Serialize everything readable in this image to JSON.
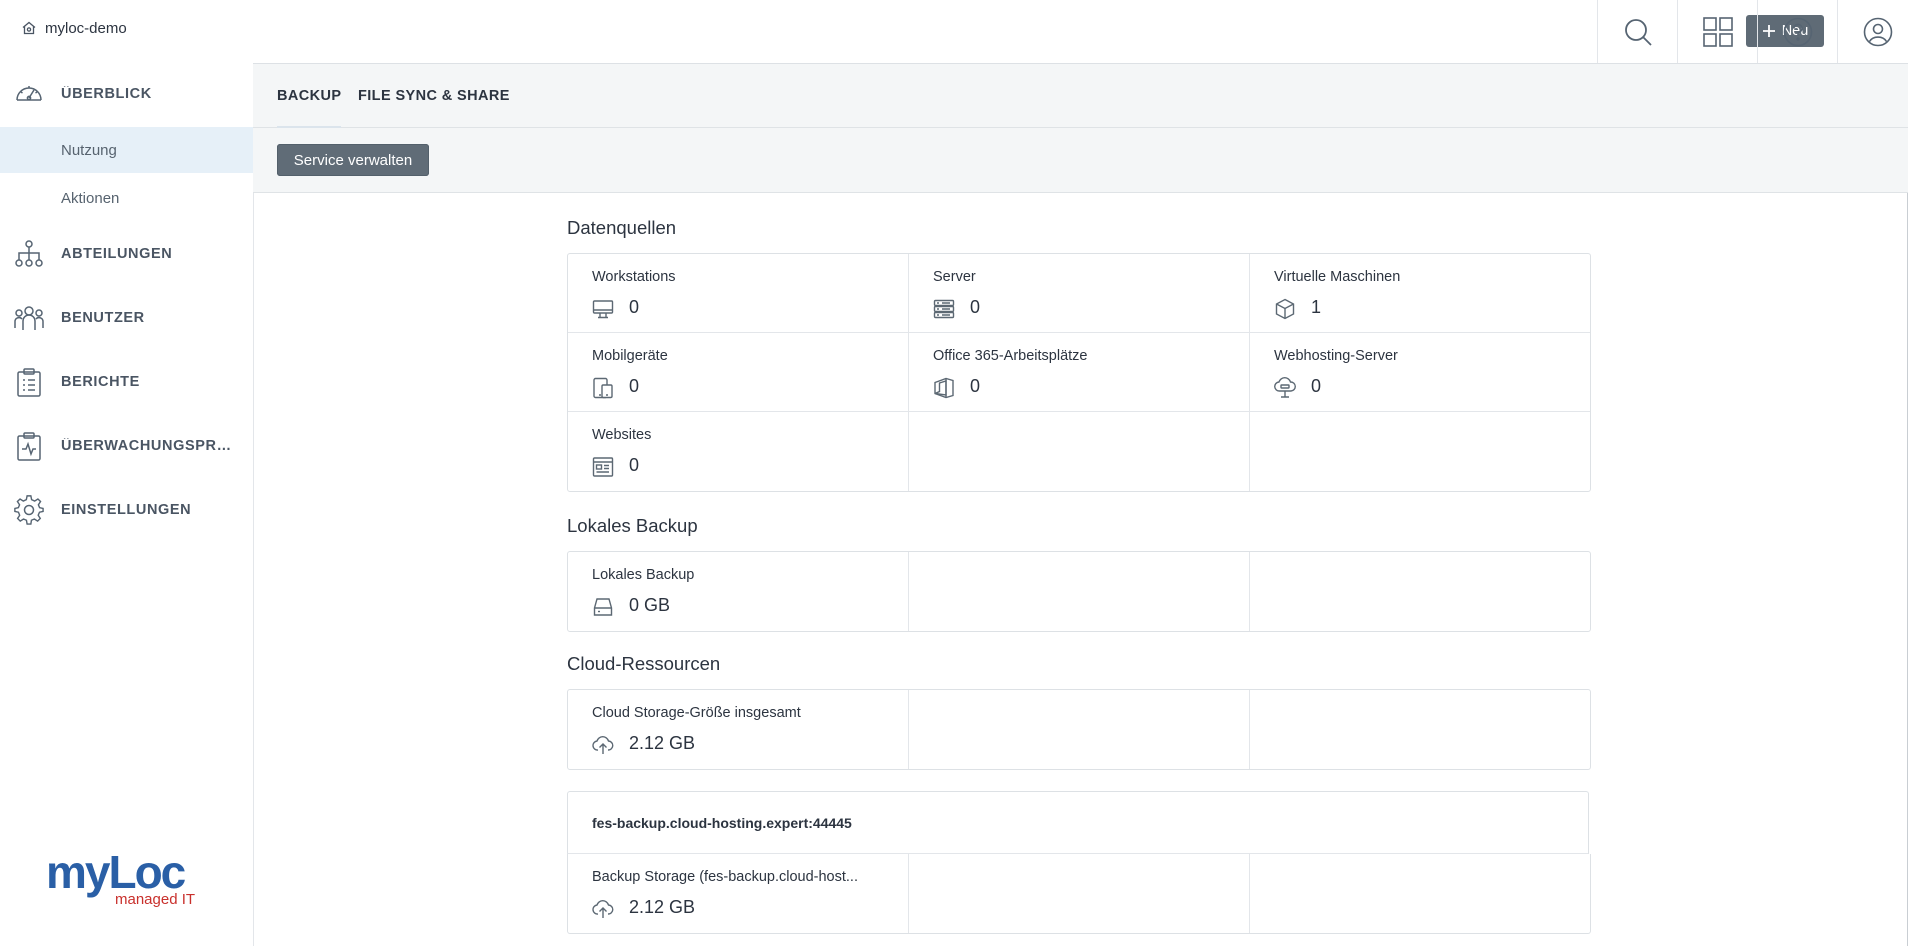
{
  "tenant": {
    "name": "myloc-demo",
    "icon": "home-icon"
  },
  "sidebar": {
    "items": [
      {
        "label": "ÜBERBLICK",
        "icon": "dashboard-icon"
      },
      {
        "label": "ABTEILUNGEN",
        "icon": "hierarchy-icon"
      },
      {
        "label": "BENUTZER",
        "icon": "users-icon"
      },
      {
        "label": "BERICHTE",
        "icon": "clipboard-report-icon"
      },
      {
        "label": "ÜBERWACHUNGSPROT...",
        "icon": "clipboard-monitor-icon"
      },
      {
        "label": "EINSTELLUNGEN",
        "icon": "gear-icon"
      }
    ],
    "subitems": [
      {
        "label": "Nutzung",
        "active": true
      },
      {
        "label": "Aktionen",
        "active": false
      }
    ],
    "logo": {
      "brand": "myLoc",
      "tagline": "managed IT",
      "brand_color": "#2a5fa6",
      "tagline_color": "#c9302c"
    }
  },
  "topbar": {
    "new_label": "Neu",
    "icons": [
      "search-icon",
      "apps-grid-icon",
      "help-icon",
      "account-icon"
    ]
  },
  "tabs": [
    {
      "label": "BACKUP",
      "active": true
    },
    {
      "label": "FILE SYNC & SHARE",
      "active": false
    }
  ],
  "toolbar": {
    "service_label": "Service verwalten"
  },
  "sections": {
    "datasources": {
      "title": "Datenquellen",
      "cells": [
        {
          "label": "Workstations",
          "value": "0",
          "icon": "monitor-icon"
        },
        {
          "label": "Server",
          "value": "0",
          "icon": "server-icon"
        },
        {
          "label": "Virtuelle Maschinen",
          "value": "1",
          "icon": "cube-icon"
        },
        {
          "label": "Mobilgeräte",
          "value": "0",
          "icon": "mobile-devices-icon"
        },
        {
          "label": "Office 365-Arbeitsplätze",
          "value": "0",
          "icon": "office365-icon"
        },
        {
          "label": "Webhosting-Server",
          "value": "0",
          "icon": "cloud-server-icon"
        },
        {
          "label": "Websites",
          "value": "0",
          "icon": "website-icon"
        }
      ]
    },
    "local_backup": {
      "title": "Lokales Backup",
      "cells": [
        {
          "label": "Lokales Backup",
          "value": "0 GB",
          "icon": "hard-drive-icon"
        }
      ]
    },
    "cloud": {
      "title": "Cloud-Ressourcen",
      "cells": [
        {
          "label": "Cloud Storage-Größe insgesamt",
          "value": "2.12 GB",
          "icon": "cloud-upload-icon"
        }
      ]
    },
    "storage": {
      "host": "fes-backup.cloud-hosting.expert:44445",
      "cells": [
        {
          "label": "Backup Storage (fes-backup.cloud-host...",
          "value": "2.12 GB",
          "icon": "cloud-upload-icon"
        }
      ]
    }
  }
}
